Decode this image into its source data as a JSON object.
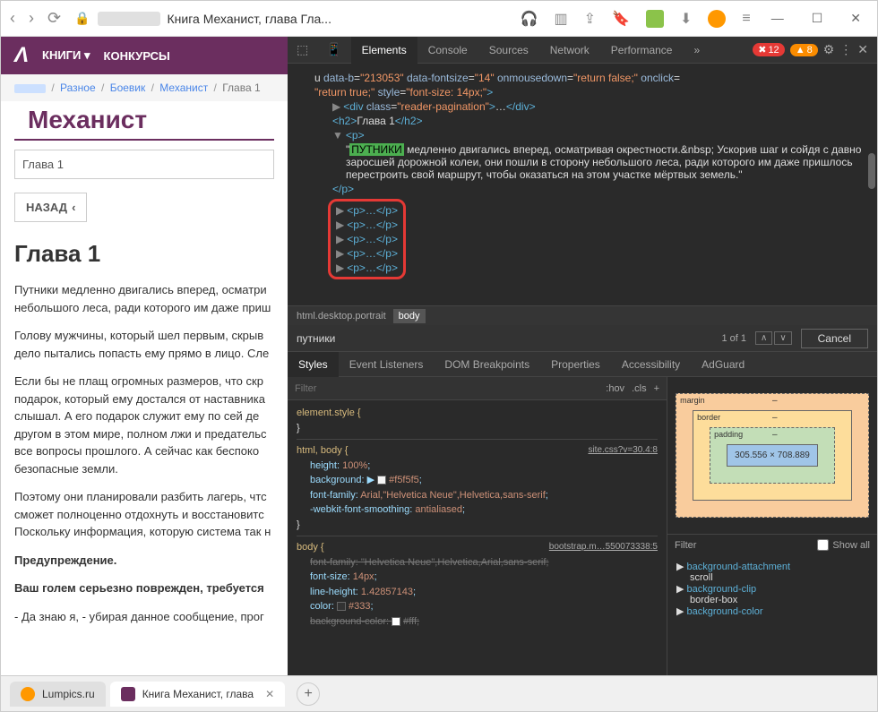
{
  "window": {
    "tab_title": "Книга Механист, глава Гла...",
    "toolbar": {
      "minimize": "—",
      "maximize": "☐",
      "close": "✕"
    }
  },
  "site": {
    "nav_books": "КНИГИ",
    "nav_contests": "КОНКУРСЫ"
  },
  "breadcrumb": {
    "item1": "Разное",
    "item2": "Боевик",
    "item3": "Механист",
    "current": "Глава 1"
  },
  "page": {
    "title": "Механист",
    "chapter_select": "Глава 1",
    "back_btn": "НАЗАД",
    "h1": "Глава 1",
    "p1": "Путники медленно двигались вперед, осматри небольшого леса, ради которого им даже приш",
    "p2": "Голову мужчины, который шел первым, скрыв дело пытались попасть ему прямо в лицо. Сле",
    "p3": "Если бы не плащ огромных размеров, что скр подарок, который ему достался от наставника слышал. А его подарок служит ему по сей де другом в этом мире, полном лжи и предательс все вопросы прошлого. А сейчас как беспоко безопасные земли.",
    "p4": "Поэтому они планировали разбить лагерь, чтс сможет полноценно отдохнуть и восстановитс Поскольку информация, которую система так н",
    "p5": "Предупреждение.",
    "p6": "Ваш голем серьезно поврежден, требуется",
    "p7": "- Да знаю я, - убирая данное сообщение, прог"
  },
  "devtools": {
    "tabs": {
      "elements": "Elements",
      "console": "Console",
      "sources": "Sources",
      "network": "Network",
      "performance": "Performance"
    },
    "errors": "12",
    "warnings": "8",
    "dom": {
      "attr_b": "213053",
      "attr_fontsize": "14",
      "attr_mousedown": "return false;",
      "attr_click": "return true;",
      "attr_style": "font-size: 14px;",
      "div_class": "reader-pagination",
      "h2_text": "Глава 1",
      "highlight": "ПУТНИКИ",
      "p_text": " медленно двигались вперед, осматривая окрестности.&nbsp; Ускорив шаг и сойдя с давно заросшей дорожной колеи, они пошли в сторону небольшого леса, ради которого им даже пришлось перестроить свой маршрут, чтобы оказаться на этом участке мёртвых земель.",
      "collapsed": "<p>…</p>"
    },
    "breadcrumb": {
      "html": "html.desktop.portrait",
      "body": "body"
    },
    "search": {
      "value": "путники",
      "count": "1 of 1",
      "cancel": "Cancel"
    },
    "styles_tabs": {
      "styles": "Styles",
      "listeners": "Event Listeners",
      "dom_bp": "DOM Breakpoints",
      "props": "Properties",
      "a11y": "Accessibility",
      "adguard": "AdGuard"
    },
    "filter": {
      "placeholder": "Filter",
      "hov": ":hov",
      "cls": ".cls"
    },
    "css": {
      "element_style": "element.style {",
      "brace": "}",
      "rule1_sel": "html, body {",
      "rule1_link": "site.css?v=30.4:8",
      "prop_height": "height",
      "val_height": "100%",
      "prop_bg": "background",
      "val_bg": "#f5f5f5",
      "prop_ff": "font-family",
      "val_ff": "Arial,\"Helvetica Neue\",Helvetica,sans-serif",
      "prop_smooth": "-webkit-font-smoothing",
      "val_smooth": "antialiased",
      "rule2_sel": "body {",
      "rule2_link": "bootstrap.m…550073338:5",
      "prop_ff2": "font-family",
      "val_ff2": "\"Helvetica Neue\",Helvetica,Arial,sans-serif",
      "prop_fs": "font-size",
      "val_fs": "14px",
      "prop_lh": "line-height",
      "val_lh": "1.42857143",
      "prop_color": "color",
      "val_color": "#333",
      "prop_bgc": "background-color",
      "val_bgc": "#fff"
    },
    "box_model": {
      "margin": "margin",
      "border": "border",
      "padding": "padding",
      "content": "305.556 × 708.889",
      "dash": "–"
    },
    "computed": {
      "filter": "Filter",
      "show_all": "Show all",
      "p1": "background-attachment",
      "v1": "scroll",
      "p2": "background-clip",
      "v2": "border-box",
      "p3": "background-color"
    }
  },
  "tabs": {
    "tab1": "Lumpics.ru",
    "tab2": "Книга Механист, глава"
  }
}
